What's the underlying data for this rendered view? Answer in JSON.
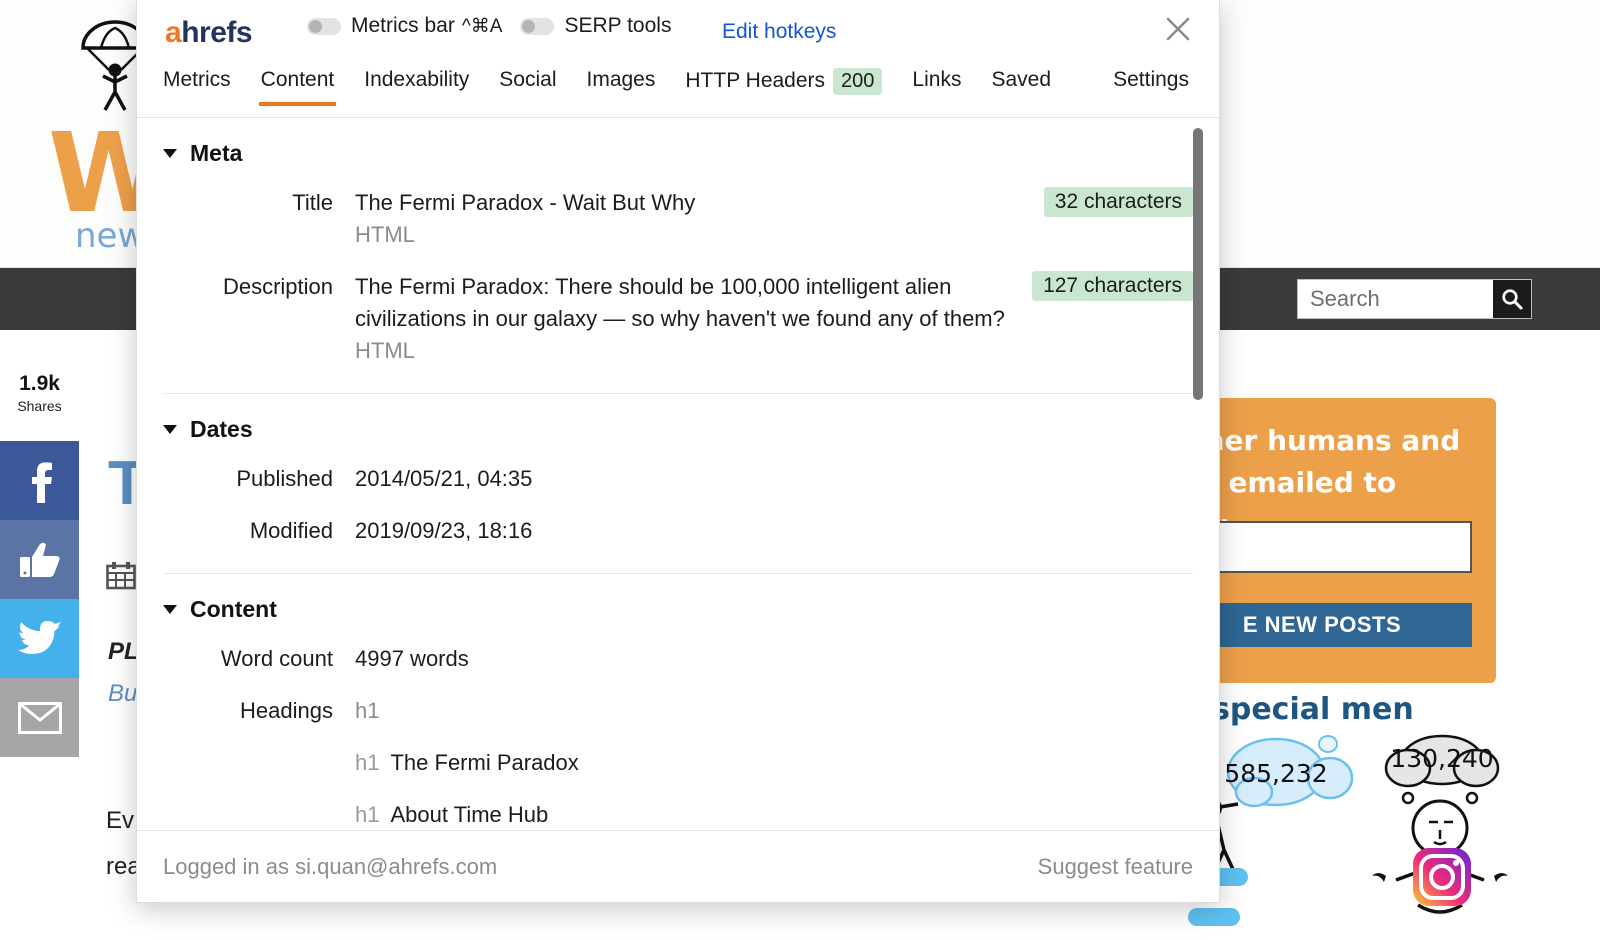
{
  "background": {
    "site_logo_w": "W",
    "site_logo_new": "new",
    "search_placeholder": "Search",
    "search_icon": "search-icon",
    "shares_count": "1.9k",
    "shares_label": "Shares",
    "social_buttons": [
      {
        "name": "facebook",
        "glyph": "f",
        "color": "#3b5998"
      },
      {
        "name": "facebook-like",
        "glyph": "thumbs-up",
        "color": "#5c73a6"
      },
      {
        "name": "twitter",
        "glyph": "bird",
        "color": "#44b0ec"
      },
      {
        "name": "email",
        "glyph": "envelope",
        "color": "#a6a6a6"
      }
    ],
    "article_title_fragment": "T",
    "article_pl_fragment": "PL",
    "article_bu_fragment": "Bu",
    "article_body_line1": "Ev",
    "article_body_line2": "rea",
    "signup_line1": "other humans and",
    "signup_line2": "sts emailed to you.",
    "signup_button": "E NEW POSTS",
    "special_men_heading": "ese special men",
    "bubble_number": "585,232",
    "thought_number": "130,240",
    "accent_orange": "#eda04a",
    "navbar_dark": "#3b3b3b",
    "heading_blue": "#1f5582"
  },
  "panel": {
    "brand": {
      "a": "a",
      "rest": "hrefs"
    },
    "toggles": [
      {
        "label": "Metrics bar",
        "hotkey": "^⌘A",
        "state": "off"
      },
      {
        "label": "SERP tools",
        "hotkey": "",
        "state": "off"
      }
    ],
    "edit_hotkeys": "Edit hotkeys",
    "close_icon": "close-icon",
    "tabs": [
      {
        "label": "Metrics",
        "active": false
      },
      {
        "label": "Content",
        "active": true
      },
      {
        "label": "Indexability",
        "active": false
      },
      {
        "label": "Social",
        "active": false
      },
      {
        "label": "Images",
        "active": false
      },
      {
        "label": "HTTP Headers",
        "active": false,
        "badge": "200"
      },
      {
        "label": "Links",
        "active": false
      },
      {
        "label": "Saved",
        "active": false
      }
    ],
    "settings_tab": "Settings",
    "accent": "#ef7622",
    "badge_bg": "#c8e6d0",
    "sections": {
      "meta": {
        "title": "Meta",
        "title_label": "Title",
        "title_value": "The Fermi Paradox - Wait But Why",
        "title_source": "HTML",
        "title_chars": "32 characters",
        "desc_label": "Description",
        "desc_value": "The Fermi Paradox: There should be 100,000 intelligent alien civilizations in our galaxy — so why haven't we found any of them?",
        "desc_source": "HTML",
        "desc_chars": "127 characters"
      },
      "dates": {
        "title": "Dates",
        "published_label": "Published",
        "published_value": "2014/05/21, 04:35",
        "modified_label": "Modified",
        "modified_value": "2019/09/23, 18:16"
      },
      "content": {
        "title": "Content",
        "word_count_label": "Word count",
        "word_count_value": "4997 words",
        "headings_label": "Headings",
        "headings_summary_tag": "h1",
        "headings": [
          {
            "tag": "h1",
            "text": "The Fermi Paradox"
          },
          {
            "tag": "h1",
            "text": "About Time Hub"
          }
        ]
      }
    },
    "footer": {
      "logged_in": "Logged in as si.quan@ahrefs.com",
      "suggest": "Suggest feature"
    }
  }
}
